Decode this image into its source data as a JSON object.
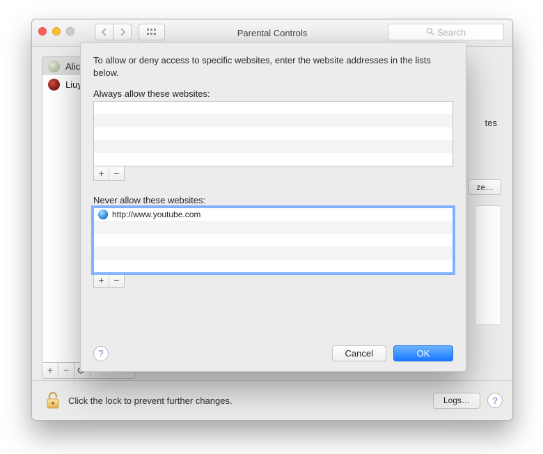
{
  "window": {
    "title": "Parental Controls",
    "search_placeholder": "Search"
  },
  "sidebar": {
    "items": [
      {
        "label": "Alice"
      },
      {
        "label": "Liuy"
      }
    ],
    "selected_index": 0
  },
  "peek": {
    "text_fragment": "tes",
    "customize_label": "ze…"
  },
  "footer": {
    "lock_text": "Click the lock to prevent further changes.",
    "logs_label": "Logs…"
  },
  "sheet": {
    "intro": "To allow or deny access to specific websites, enter the website addresses in the lists below.",
    "always_label": "Always allow these websites:",
    "never_label": "Never allow these websites:",
    "never_items": [
      {
        "url": "http://www.youtube.com"
      }
    ],
    "add_symbol": "+",
    "remove_symbol": "−",
    "cancel_label": "Cancel",
    "ok_label": "OK"
  }
}
